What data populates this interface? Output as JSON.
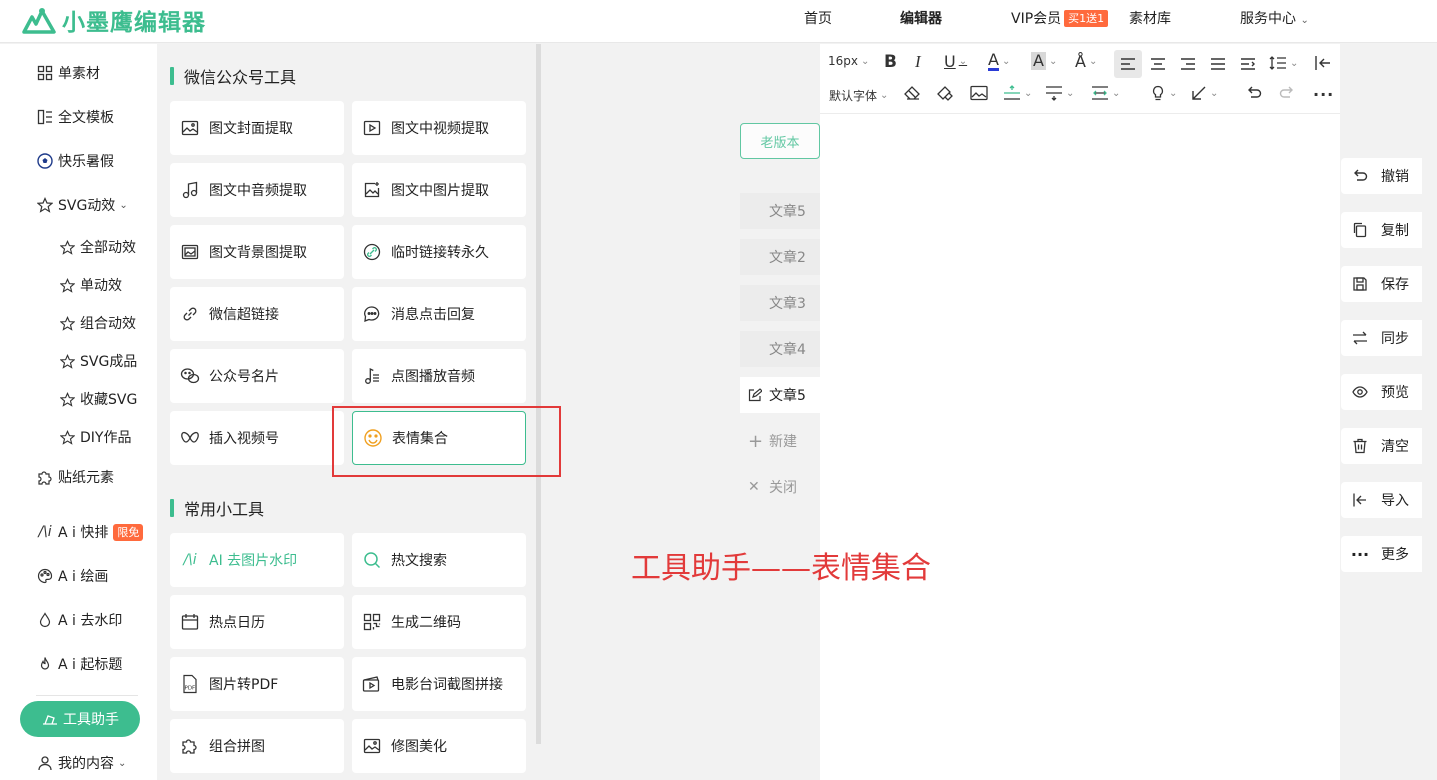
{
  "app": {
    "logo_text": "小墨鹰编辑器"
  },
  "nav": {
    "home": "首页",
    "editor": "编辑器",
    "vip": "VIP会员",
    "vip_badge": "买1送1",
    "materials": "素材库",
    "service": "服务中心"
  },
  "sidebar": {
    "items": [
      {
        "label": "单素材",
        "icon": "grid-icon"
      },
      {
        "label": "全文模板",
        "icon": "template-icon"
      },
      {
        "label": "快乐暑假",
        "icon": "soccer-ball-icon"
      },
      {
        "label": "SVG动效",
        "icon": "star-icon"
      }
    ],
    "svg_sub": [
      "全部动效",
      "单动效",
      "组合动效",
      "SVG成品",
      "收藏SVG",
      "DIY作品"
    ],
    "stickers": "贴纸元素",
    "ai_layout": "A i 快排",
    "ai_layout_badge": "限免",
    "ai_paint": "A i 绘画",
    "ai_watermark": "A i 去水印",
    "ai_title": "A i 起标题",
    "tool_helper": "工具助手",
    "my_content": "我的内容"
  },
  "panel": {
    "section1_title": "微信公众号工具",
    "section1": [
      {
        "label": "图文封面提取",
        "icon": "image-icon"
      },
      {
        "label": "图文中视频提取",
        "icon": "video-icon"
      },
      {
        "label": "图文中音频提取",
        "icon": "music-note-icon"
      },
      {
        "label": "图文中图片提取",
        "icon": "image-plus-icon"
      },
      {
        "label": "图文背景图提取",
        "icon": "background-image-icon"
      },
      {
        "label": "临时链接转永久",
        "icon": "link-circle-icon"
      },
      {
        "label": "微信超链接",
        "icon": "link-icon"
      },
      {
        "label": "消息点击回复",
        "icon": "chat-bubble-icon"
      },
      {
        "label": "公众号名片",
        "icon": "wechat-icon"
      },
      {
        "label": "点图播放音频",
        "icon": "music-list-icon"
      },
      {
        "label": "插入视频号",
        "icon": "channels-icon"
      },
      {
        "label": "表情集合",
        "icon": "smiley-icon"
      }
    ],
    "section2_title": "常用小工具",
    "section2": [
      {
        "label": "AI 去图片水印",
        "icon": "ai-icon"
      },
      {
        "label": "热文搜索",
        "icon": "search-icon"
      },
      {
        "label": "热点日历",
        "icon": "calendar-icon"
      },
      {
        "label": "生成二维码",
        "icon": "qrcode-icon"
      },
      {
        "label": "图片转PDF",
        "icon": "pdf-icon"
      },
      {
        "label": "电影台词截图拼接",
        "icon": "film-icon"
      },
      {
        "label": "组合拼图",
        "icon": "puzzle-icon"
      },
      {
        "label": "修图美化",
        "icon": "photo-edit-icon"
      }
    ]
  },
  "articles": {
    "old_version": "老版本",
    "tabs": [
      "文章5",
      "文章2",
      "文章3",
      "文章4",
      "文章5"
    ],
    "new": "新建",
    "close": "关闭"
  },
  "caption": "工具助手——表情集合",
  "toolbar": {
    "font_size": "16px",
    "font_family": "默认字体"
  },
  "right_actions": [
    {
      "label": "撤销",
      "icon": "undo-icon"
    },
    {
      "label": "复制",
      "icon": "copy-icon"
    },
    {
      "label": "保存",
      "icon": "save-icon"
    },
    {
      "label": "同步",
      "icon": "sync-icon"
    },
    {
      "label": "预览",
      "icon": "eye-icon"
    },
    {
      "label": "清空",
      "icon": "trash-icon"
    },
    {
      "label": "导入",
      "icon": "import-icon"
    },
    {
      "label": "更多",
      "icon": "more-icon"
    }
  ],
  "colors": {
    "accent": "#3dbd8f",
    "badge": "#ff6a3d",
    "annotation": "#e23a3a"
  }
}
